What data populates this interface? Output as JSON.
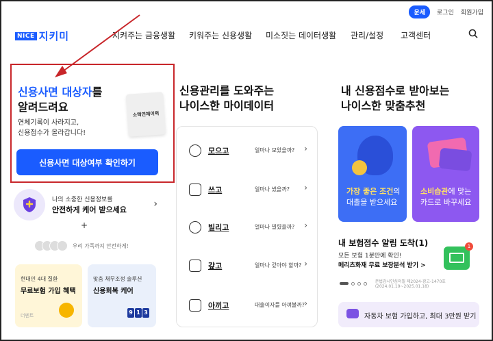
{
  "util": {
    "login_pill": "로그인",
    "login": "로그인",
    "signup": "회원가입",
    "pill": "운세"
  },
  "logo": {
    "badge": "NICE",
    "name": "지키미"
  },
  "nav": [
    "지켜주는 금융생활",
    "키워주는 신용생활",
    "미소짓는 데이터생활",
    "관리/설정",
    "고객센터"
  ],
  "hero": {
    "title_blue": "신용사면 대상자",
    "title_rest": "를",
    "title_line2": "알려드려요",
    "sub1": "연체기록이 사라지고,",
    "sub2": "신용점수가 올라갑니다!",
    "doc_label": "소액연체이력",
    "cta": "신용사면 대상여부 확인하기"
  },
  "protect": {
    "line1": "나의 소중한 신용정보를",
    "line2": "안전하게 케어 받으세요",
    "plus": "+"
  },
  "family": {
    "text": "우리 가족까지 안전하게!"
  },
  "cards": [
    {
      "sub": "현대인 4대 질환",
      "title": "무료보험 가입 혜택",
      "foot": "더펜트"
    },
    {
      "sub": "맞춤 채무조정 솔루션",
      "title": "신용회복 케어",
      "digits": [
        "9",
        "1",
        "3"
      ]
    }
  ],
  "mydata": {
    "title1": "신용관리를 도와주는",
    "title2": "나이스한 마이데이터",
    "items": [
      {
        "label": "모으고",
        "q": "얼마나 모았을까?"
      },
      {
        "label": "쓰고",
        "q": "얼마나 썼을까?"
      },
      {
        "label": "빌리고",
        "q": "얼마나 빌렸을까?"
      },
      {
        "label": "갚고",
        "q": "얼마나 갚아야 할까?"
      },
      {
        "label": "아끼고",
        "q": "대출이자를 아껴볼까?"
      }
    ]
  },
  "recommend": {
    "title1": "내 신용점수로 받아보는",
    "title2": "나이스한 맞춤추천",
    "blue_card": {
      "hl": "가장 좋은 조건",
      "rest": "의",
      "line2": "대출을 받으세요"
    },
    "purple_card": {
      "hl": "소비습관",
      "rest": "에 맞는",
      "line2": "카드로 바꾸세요"
    }
  },
  "insurance": {
    "title": "내 보험점수 알림 도착(1)",
    "line1": "모든 보험 1분만에 확인!",
    "line2": "메리츠화재 무료 보장분석 받기 >",
    "badge": "1",
    "meta": "준법감시인심의필 제2024-광고-1470호(2024.01.19~2025.01.18)"
  },
  "car": {
    "text": "자동차 보험 가입하고, 최대 3만원 받기"
  },
  "colors": {
    "accent": "#1a5cff",
    "highlight_box": "#c8262a",
    "purple": "#8d58f0"
  }
}
